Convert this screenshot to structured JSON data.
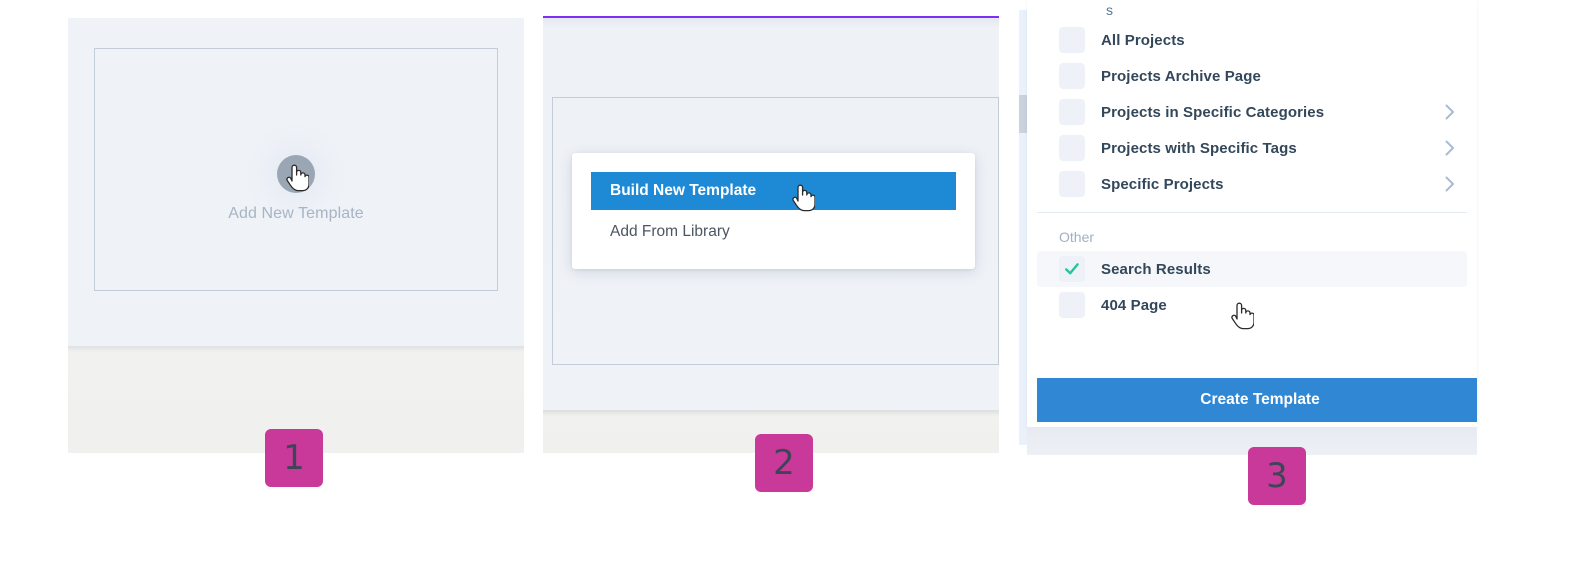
{
  "colors": {
    "accent_blue": "#1e8ad6",
    "button_blue": "#3087d4",
    "badge_pink": "#c9399a",
    "badge_number": "#3d4657",
    "check_green": "#22c79a",
    "purple_rule": "#7b2ff7",
    "panel_bg": "#eff2f7",
    "text_dark": "#33475b",
    "text_muted": "#9fb0c4"
  },
  "step1": {
    "badge": "1",
    "plus_icon": "plus-icon",
    "add_label": "Add New Template",
    "cursor": "hand-pointer-cursor"
  },
  "step2": {
    "badge": "2",
    "menu": {
      "items": [
        {
          "label": "Build New Template",
          "selected": true
        },
        {
          "label": "Add From Library",
          "selected": false
        }
      ]
    },
    "cursor": "hand-pointer-cursor"
  },
  "step3": {
    "badge": "3",
    "clipped_top_text": "s",
    "groups": [
      {
        "heading": null,
        "rows": [
          {
            "label": "All Projects",
            "checked": false,
            "chevron": false,
            "highlight": false
          },
          {
            "label": "Projects Archive Page",
            "checked": false,
            "chevron": false,
            "highlight": false
          },
          {
            "label": "Projects in Specific Categories",
            "checked": false,
            "chevron": true,
            "highlight": false
          },
          {
            "label": "Projects with Specific Tags",
            "checked": false,
            "chevron": true,
            "highlight": false
          },
          {
            "label": "Specific Projects",
            "checked": false,
            "chevron": true,
            "highlight": false
          }
        ]
      },
      {
        "heading": "Other",
        "rows": [
          {
            "label": "Search Results",
            "checked": true,
            "chevron": false,
            "highlight": true
          },
          {
            "label": "404 Page",
            "checked": false,
            "chevron": false,
            "highlight": false
          }
        ]
      }
    ],
    "create_button": "Create Template",
    "cursor": "hand-pointer-cursor"
  }
}
